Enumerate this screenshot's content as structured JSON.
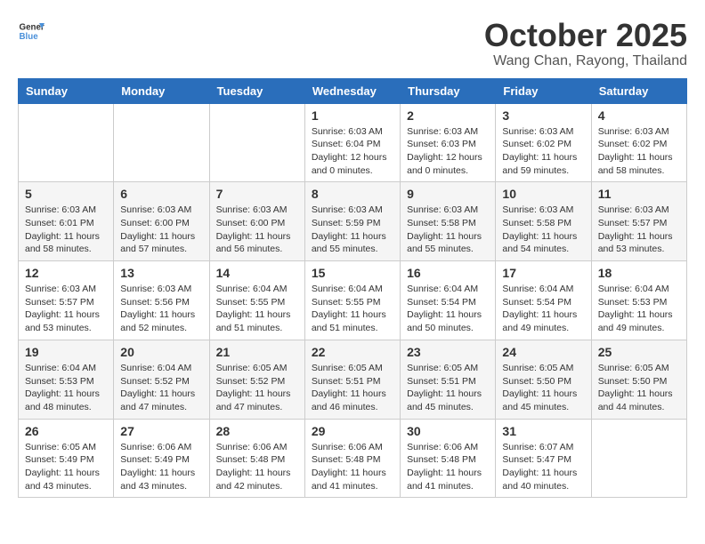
{
  "header": {
    "logo_line1": "General",
    "logo_line2": "Blue",
    "month": "October 2025",
    "location": "Wang Chan, Rayong, Thailand"
  },
  "weekdays": [
    "Sunday",
    "Monday",
    "Tuesday",
    "Wednesday",
    "Thursday",
    "Friday",
    "Saturday"
  ],
  "weeks": [
    [
      {
        "day": "",
        "info": ""
      },
      {
        "day": "",
        "info": ""
      },
      {
        "day": "",
        "info": ""
      },
      {
        "day": "1",
        "info": "Sunrise: 6:03 AM\nSunset: 6:04 PM\nDaylight: 12 hours\nand 0 minutes."
      },
      {
        "day": "2",
        "info": "Sunrise: 6:03 AM\nSunset: 6:03 PM\nDaylight: 12 hours\nand 0 minutes."
      },
      {
        "day": "3",
        "info": "Sunrise: 6:03 AM\nSunset: 6:02 PM\nDaylight: 11 hours\nand 59 minutes."
      },
      {
        "day": "4",
        "info": "Sunrise: 6:03 AM\nSunset: 6:02 PM\nDaylight: 11 hours\nand 58 minutes."
      }
    ],
    [
      {
        "day": "5",
        "info": "Sunrise: 6:03 AM\nSunset: 6:01 PM\nDaylight: 11 hours\nand 58 minutes."
      },
      {
        "day": "6",
        "info": "Sunrise: 6:03 AM\nSunset: 6:00 PM\nDaylight: 11 hours\nand 57 minutes."
      },
      {
        "day": "7",
        "info": "Sunrise: 6:03 AM\nSunset: 6:00 PM\nDaylight: 11 hours\nand 56 minutes."
      },
      {
        "day": "8",
        "info": "Sunrise: 6:03 AM\nSunset: 5:59 PM\nDaylight: 11 hours\nand 55 minutes."
      },
      {
        "day": "9",
        "info": "Sunrise: 6:03 AM\nSunset: 5:58 PM\nDaylight: 11 hours\nand 55 minutes."
      },
      {
        "day": "10",
        "info": "Sunrise: 6:03 AM\nSunset: 5:58 PM\nDaylight: 11 hours\nand 54 minutes."
      },
      {
        "day": "11",
        "info": "Sunrise: 6:03 AM\nSunset: 5:57 PM\nDaylight: 11 hours\nand 53 minutes."
      }
    ],
    [
      {
        "day": "12",
        "info": "Sunrise: 6:03 AM\nSunset: 5:57 PM\nDaylight: 11 hours\nand 53 minutes."
      },
      {
        "day": "13",
        "info": "Sunrise: 6:03 AM\nSunset: 5:56 PM\nDaylight: 11 hours\nand 52 minutes."
      },
      {
        "day": "14",
        "info": "Sunrise: 6:04 AM\nSunset: 5:55 PM\nDaylight: 11 hours\nand 51 minutes."
      },
      {
        "day": "15",
        "info": "Sunrise: 6:04 AM\nSunset: 5:55 PM\nDaylight: 11 hours\nand 51 minutes."
      },
      {
        "day": "16",
        "info": "Sunrise: 6:04 AM\nSunset: 5:54 PM\nDaylight: 11 hours\nand 50 minutes."
      },
      {
        "day": "17",
        "info": "Sunrise: 6:04 AM\nSunset: 5:54 PM\nDaylight: 11 hours\nand 49 minutes."
      },
      {
        "day": "18",
        "info": "Sunrise: 6:04 AM\nSunset: 5:53 PM\nDaylight: 11 hours\nand 49 minutes."
      }
    ],
    [
      {
        "day": "19",
        "info": "Sunrise: 6:04 AM\nSunset: 5:53 PM\nDaylight: 11 hours\nand 48 minutes."
      },
      {
        "day": "20",
        "info": "Sunrise: 6:04 AM\nSunset: 5:52 PM\nDaylight: 11 hours\nand 47 minutes."
      },
      {
        "day": "21",
        "info": "Sunrise: 6:05 AM\nSunset: 5:52 PM\nDaylight: 11 hours\nand 47 minutes."
      },
      {
        "day": "22",
        "info": "Sunrise: 6:05 AM\nSunset: 5:51 PM\nDaylight: 11 hours\nand 46 minutes."
      },
      {
        "day": "23",
        "info": "Sunrise: 6:05 AM\nSunset: 5:51 PM\nDaylight: 11 hours\nand 45 minutes."
      },
      {
        "day": "24",
        "info": "Sunrise: 6:05 AM\nSunset: 5:50 PM\nDaylight: 11 hours\nand 45 minutes."
      },
      {
        "day": "25",
        "info": "Sunrise: 6:05 AM\nSunset: 5:50 PM\nDaylight: 11 hours\nand 44 minutes."
      }
    ],
    [
      {
        "day": "26",
        "info": "Sunrise: 6:05 AM\nSunset: 5:49 PM\nDaylight: 11 hours\nand 43 minutes."
      },
      {
        "day": "27",
        "info": "Sunrise: 6:06 AM\nSunset: 5:49 PM\nDaylight: 11 hours\nand 43 minutes."
      },
      {
        "day": "28",
        "info": "Sunrise: 6:06 AM\nSunset: 5:48 PM\nDaylight: 11 hours\nand 42 minutes."
      },
      {
        "day": "29",
        "info": "Sunrise: 6:06 AM\nSunset: 5:48 PM\nDaylight: 11 hours\nand 41 minutes."
      },
      {
        "day": "30",
        "info": "Sunrise: 6:06 AM\nSunset: 5:48 PM\nDaylight: 11 hours\nand 41 minutes."
      },
      {
        "day": "31",
        "info": "Sunrise: 6:07 AM\nSunset: 5:47 PM\nDaylight: 11 hours\nand 40 minutes."
      },
      {
        "day": "",
        "info": ""
      }
    ]
  ]
}
